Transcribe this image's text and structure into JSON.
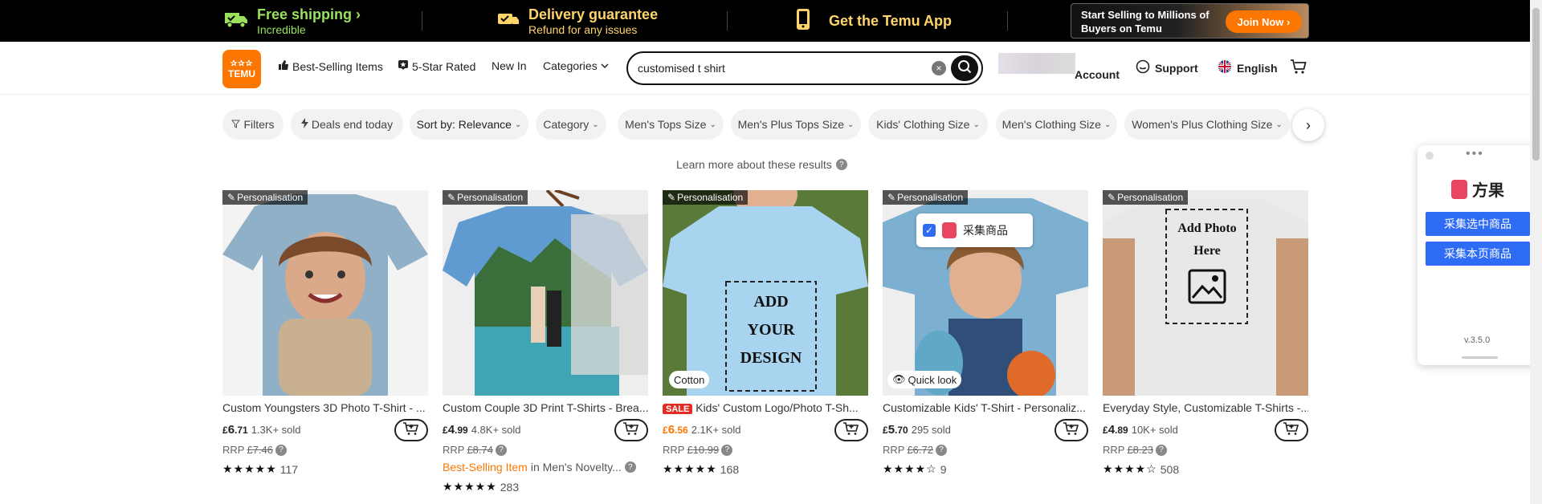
{
  "topbar": {
    "free_shipping_title": "Free shipping",
    "free_shipping_sub": "Incredible",
    "delivery_title": "Delivery guarantee",
    "delivery_sub": "Refund for any issues",
    "app_title": "Get the Temu App",
    "sell_text": "Start Selling to Millions of Buyers on Temu",
    "join_label": "Join Now"
  },
  "header": {
    "logo_line1": "✰✰✰",
    "logo_line2": "TEMU",
    "nav": [
      "Best-Selling Items",
      "5-Star Rated",
      "New In",
      "Categories"
    ],
    "search_value": "customised t shirt",
    "account_label": "Account",
    "support_label": "Support",
    "language_label": "English"
  },
  "filters": [
    "Filters",
    "Deals end today",
    "Sort by: Relevance",
    "Category",
    "Men's Tops Size",
    "Men's Plus Tops Size",
    "Kids' Clothing Size",
    "Men's Clothing Size",
    "Women's Plus Clothing Size"
  ],
  "learn_more": "Learn more about these results",
  "products": [
    {
      "badge": "Personalisation",
      "title": "Custom Youngsters 3D Photo T-Shirt - ...",
      "currency": "£",
      "price_int": "6",
      "price_dec": ".71",
      "sold": "1.3K+ sold",
      "rrp_label": "RRP",
      "rrp": "£7.46",
      "rating": 5,
      "reviews": "117"
    },
    {
      "badge": "Personalisation",
      "title": "Custom Couple 3D Print T-Shirts - Brea...",
      "currency": "£",
      "price_int": "4",
      "price_dec": ".99",
      "sold": "4.8K+ sold",
      "rrp_label": "RRP",
      "rrp": "£8.74",
      "best_selling": "Best-Selling Item",
      "best_selling_in": "in Men's Novelty...",
      "reviews": "283"
    },
    {
      "badge": "Personalisation",
      "sale": "SALE",
      "overlay": "Cotton",
      "title": "Kids' Custom Logo/Photo T-Sh...",
      "currency": "£",
      "price_int": "6",
      "price_dec": ".56",
      "sold": "2.1K+ sold",
      "rrp_label": "RRP",
      "rrp": "£10.99",
      "reviews": "168",
      "design_text": [
        "ADD",
        "YOUR",
        "DESIGN"
      ]
    },
    {
      "badge": "Personalisation",
      "overlay": "Quick look",
      "collect": "采集商品",
      "title": "Customizable Kids' T-Shirt - Personaliz...",
      "currency": "£",
      "price_int": "5",
      "price_dec": ".70",
      "sold": "295 sold",
      "rrp_label": "RRP",
      "rrp": "£6.72",
      "reviews": "9"
    },
    {
      "badge": "Personalisation",
      "title": "Everyday Style, Customizable T-Shirts -...",
      "currency": "£",
      "price_int": "4",
      "price_dec": ".89",
      "sold": "10K+ sold",
      "rrp_label": "RRP",
      "rrp": "£8.23",
      "reviews": "508",
      "design_text": [
        "Add Photo",
        "Here"
      ]
    }
  ],
  "widget": {
    "brand": "方果",
    "btn1": "采集选中商品",
    "btn2": "采集本页商品",
    "version": "v.3.5.0"
  },
  "colors": {
    "accent": "#fb7701",
    "green": "#9be15d",
    "yellow": "#ffd46b",
    "blue": "#2f6cf5"
  }
}
